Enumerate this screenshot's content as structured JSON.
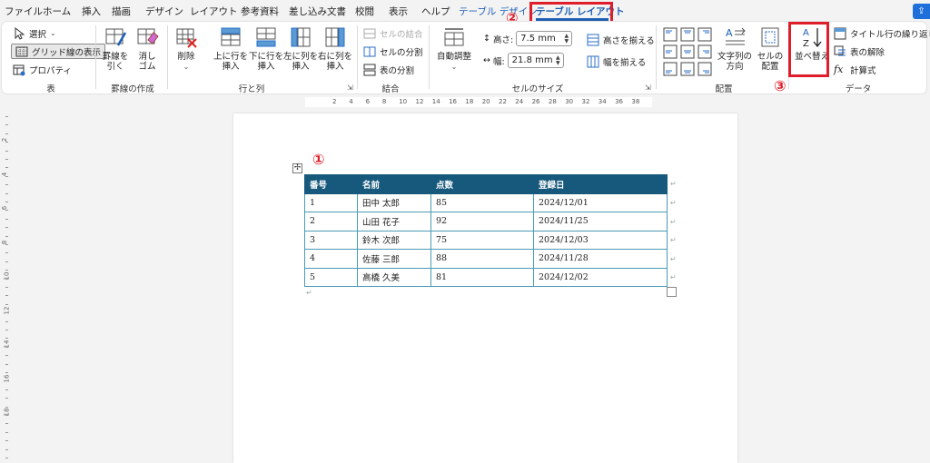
{
  "tabs": [
    {
      "label": "ファイル",
      "state": "normal"
    },
    {
      "label": "ホーム",
      "state": "normal"
    },
    {
      "label": "挿入",
      "state": "normal"
    },
    {
      "label": "描画",
      "state": "normal"
    },
    {
      "label": "デザイン",
      "state": "normal"
    },
    {
      "label": "レイアウト",
      "state": "normal"
    },
    {
      "label": "参考資料",
      "state": "normal"
    },
    {
      "label": "差し込み文書",
      "state": "normal"
    },
    {
      "label": "校閲",
      "state": "normal"
    },
    {
      "label": "表示",
      "state": "normal"
    },
    {
      "label": "ヘルプ",
      "state": "normal"
    },
    {
      "label": "テーブル デザイン",
      "state": "contextual"
    },
    {
      "label": "テーブル レイアウト",
      "state": "active"
    }
  ],
  "ribbon": {
    "table_group": {
      "label": "表",
      "select": "選択",
      "gridlines": "グリッド線の表示",
      "properties": "プロパティ"
    },
    "draw_group": {
      "label": "罫線の作成",
      "draw_table": "罫線を\n引く",
      "eraser": "消し\nゴム"
    },
    "rows_cols_group": {
      "label": "行と列",
      "delete": "削除",
      "insert_above": "上に行を\n挿入",
      "insert_below": "下に行を\n挿入",
      "insert_left": "左に列を\n挿入",
      "insert_right": "右に列を\n挿入"
    },
    "merge_group": {
      "label": "結合",
      "merge_cells": "セルの結合",
      "split_cells": "セルの分割",
      "split_table": "表の分割"
    },
    "cell_size_group": {
      "label": "セルのサイズ",
      "autofit": "自動調整",
      "height_label": "高さ:",
      "height_value": "7.5 mm",
      "width_label": "幅:",
      "width_value": "21.8 mm",
      "distribute_rows": "高さを揃える",
      "distribute_cols": "幅を揃える"
    },
    "alignment_group": {
      "label": "配置",
      "text_direction": "文字列の\n方向",
      "cell_margins": "セルの\n配置"
    },
    "data_group": {
      "label": "データ",
      "sort": "並べ替え",
      "repeat_header": "タイトル行の繰り返し",
      "convert_to_text": "表の解除",
      "formula": "計算式"
    }
  },
  "markers": {
    "m1": "①",
    "m2": "②",
    "m3": "③"
  },
  "ruler": {
    "h_numbers": [
      "2",
      "4",
      "6",
      "8",
      "10",
      "12",
      "14",
      "16",
      "18",
      "20",
      "22",
      "24",
      "26",
      "28",
      "30",
      "32",
      "34",
      "36",
      "38"
    ],
    "v_numbers": [
      "2",
      "4",
      "6",
      "8",
      "10",
      "12",
      "14",
      "16",
      "18"
    ]
  },
  "table": {
    "headers": [
      "番号",
      "名前",
      "点数",
      "登録日"
    ],
    "rows": [
      [
        "1",
        "田中 太郎",
        "85",
        "2024/12/01"
      ],
      [
        "2",
        "山田 花子",
        "92",
        "2024/11/25"
      ],
      [
        "3",
        "鈴木 次郎",
        "75",
        "2024/12/03"
      ],
      [
        "4",
        "佐藤 三郎",
        "88",
        "2024/11/28"
      ],
      [
        "5",
        "高橋 久美",
        "81",
        "2024/12/02"
      ]
    ]
  },
  "colors": {
    "accent": "#1e5fb4",
    "highlight": "#e01e2b",
    "table_header": "#17597d",
    "table_border": "#4a9ab5"
  }
}
